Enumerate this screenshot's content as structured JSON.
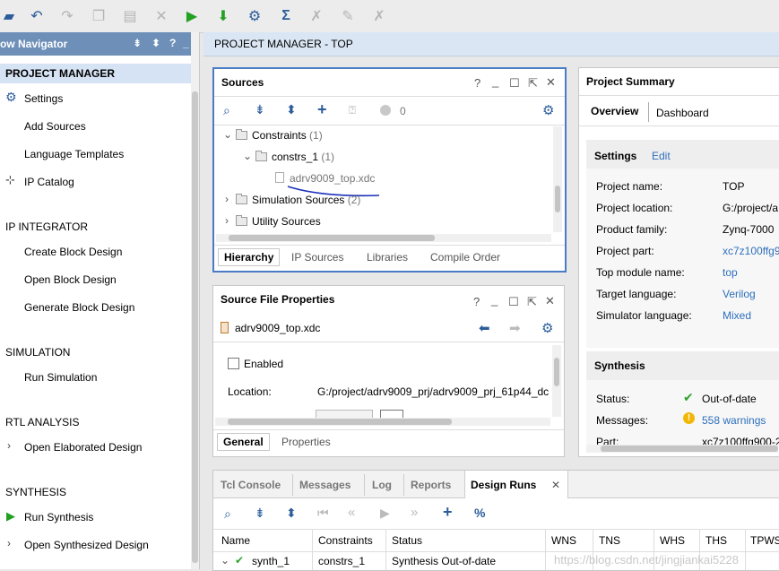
{
  "nav": {
    "title": "ow Navigator",
    "header_icons": [
      "collapse-all-icon",
      "expand-all-icon",
      "help-icon",
      "minimize-icon"
    ],
    "project_manager": {
      "label": "PROJECT MANAGER",
      "items": [
        "Settings",
        "Add Sources",
        "Language Templates",
        "IP Catalog"
      ]
    },
    "ip_integrator": {
      "label": "IP INTEGRATOR",
      "items": [
        "Create Block Design",
        "Open Block Design",
        "Generate Block Design"
      ]
    },
    "simulation": {
      "label": "SIMULATION",
      "items": [
        "Run Simulation"
      ]
    },
    "rtl_analysis": {
      "label": "RTL ANALYSIS",
      "items": [
        "Open Elaborated Design"
      ]
    },
    "synthesis": {
      "label": "SYNTHESIS",
      "items": [
        "Run Synthesis",
        "Open Synthesized Design"
      ]
    }
  },
  "main": {
    "header": "PROJECT MANAGER - TOP"
  },
  "sources": {
    "title": "Sources",
    "badge_count": "0",
    "tree": {
      "constraints": "Constraints",
      "constraints_count": "(1)",
      "constrs": "constrs_1",
      "constrs_count": "(1)",
      "file": "adrv9009_top.xdc",
      "sim": "Simulation Sources",
      "sim_count": "(2)",
      "utility": "Utility Sources"
    },
    "tabs": [
      "Hierarchy",
      "IP Sources",
      "Libraries",
      "Compile Order"
    ]
  },
  "sfp": {
    "title": "Source File Properties",
    "file": "adrv9009_top.xdc",
    "enabled_label": "Enabled",
    "location_label": "Location:",
    "location_value": "G:/project/adrv9009_prj/adrv9009_prj_61p44_dc",
    "tabs": [
      "General",
      "Properties"
    ]
  },
  "summary": {
    "title": "Project Summary",
    "tabs": [
      "Overview",
      "Dashboard"
    ],
    "settings_label": "Settings",
    "edit_label": "Edit",
    "rows": [
      {
        "k": "Project name:",
        "v": "TOP"
      },
      {
        "k": "Project location:",
        "v": "G:/project/a"
      },
      {
        "k": "Product family:",
        "v": "Zynq-7000"
      },
      {
        "k": "Project part:",
        "v": "xc7z100ffg9"
      },
      {
        "k": "Top module name:",
        "v": "top"
      },
      {
        "k": "Target language:",
        "v": "Verilog"
      },
      {
        "k": "Simulator language:",
        "v": "Mixed"
      }
    ],
    "synthesis_label": "Synthesis",
    "status_label": "Status:",
    "status_value": "Out-of-date",
    "messages_label": "Messages:",
    "messages_value": "558 warnings",
    "part_label": "Part:",
    "part_value": "xc7z100ffg900-2"
  },
  "bottom": {
    "tabs": [
      "Tcl Console",
      "Messages",
      "Log",
      "Reports",
      "Design Runs"
    ],
    "columns": [
      "Name",
      "Constraints",
      "Status",
      "WNS",
      "TNS",
      "WHS",
      "THS",
      "TPWS"
    ],
    "row": {
      "name": "synth_1",
      "constraints": "constrs_1",
      "status": "Synthesis Out-of-date"
    }
  },
  "watermark": "https://blog.csdn.net/jingjiankai5228",
  "colors": {
    "nav_header": "#6d8fb8",
    "link": "#2e6fbd",
    "panel_border_focus": "#4a7cc4",
    "run_green": "#2fa32f"
  }
}
